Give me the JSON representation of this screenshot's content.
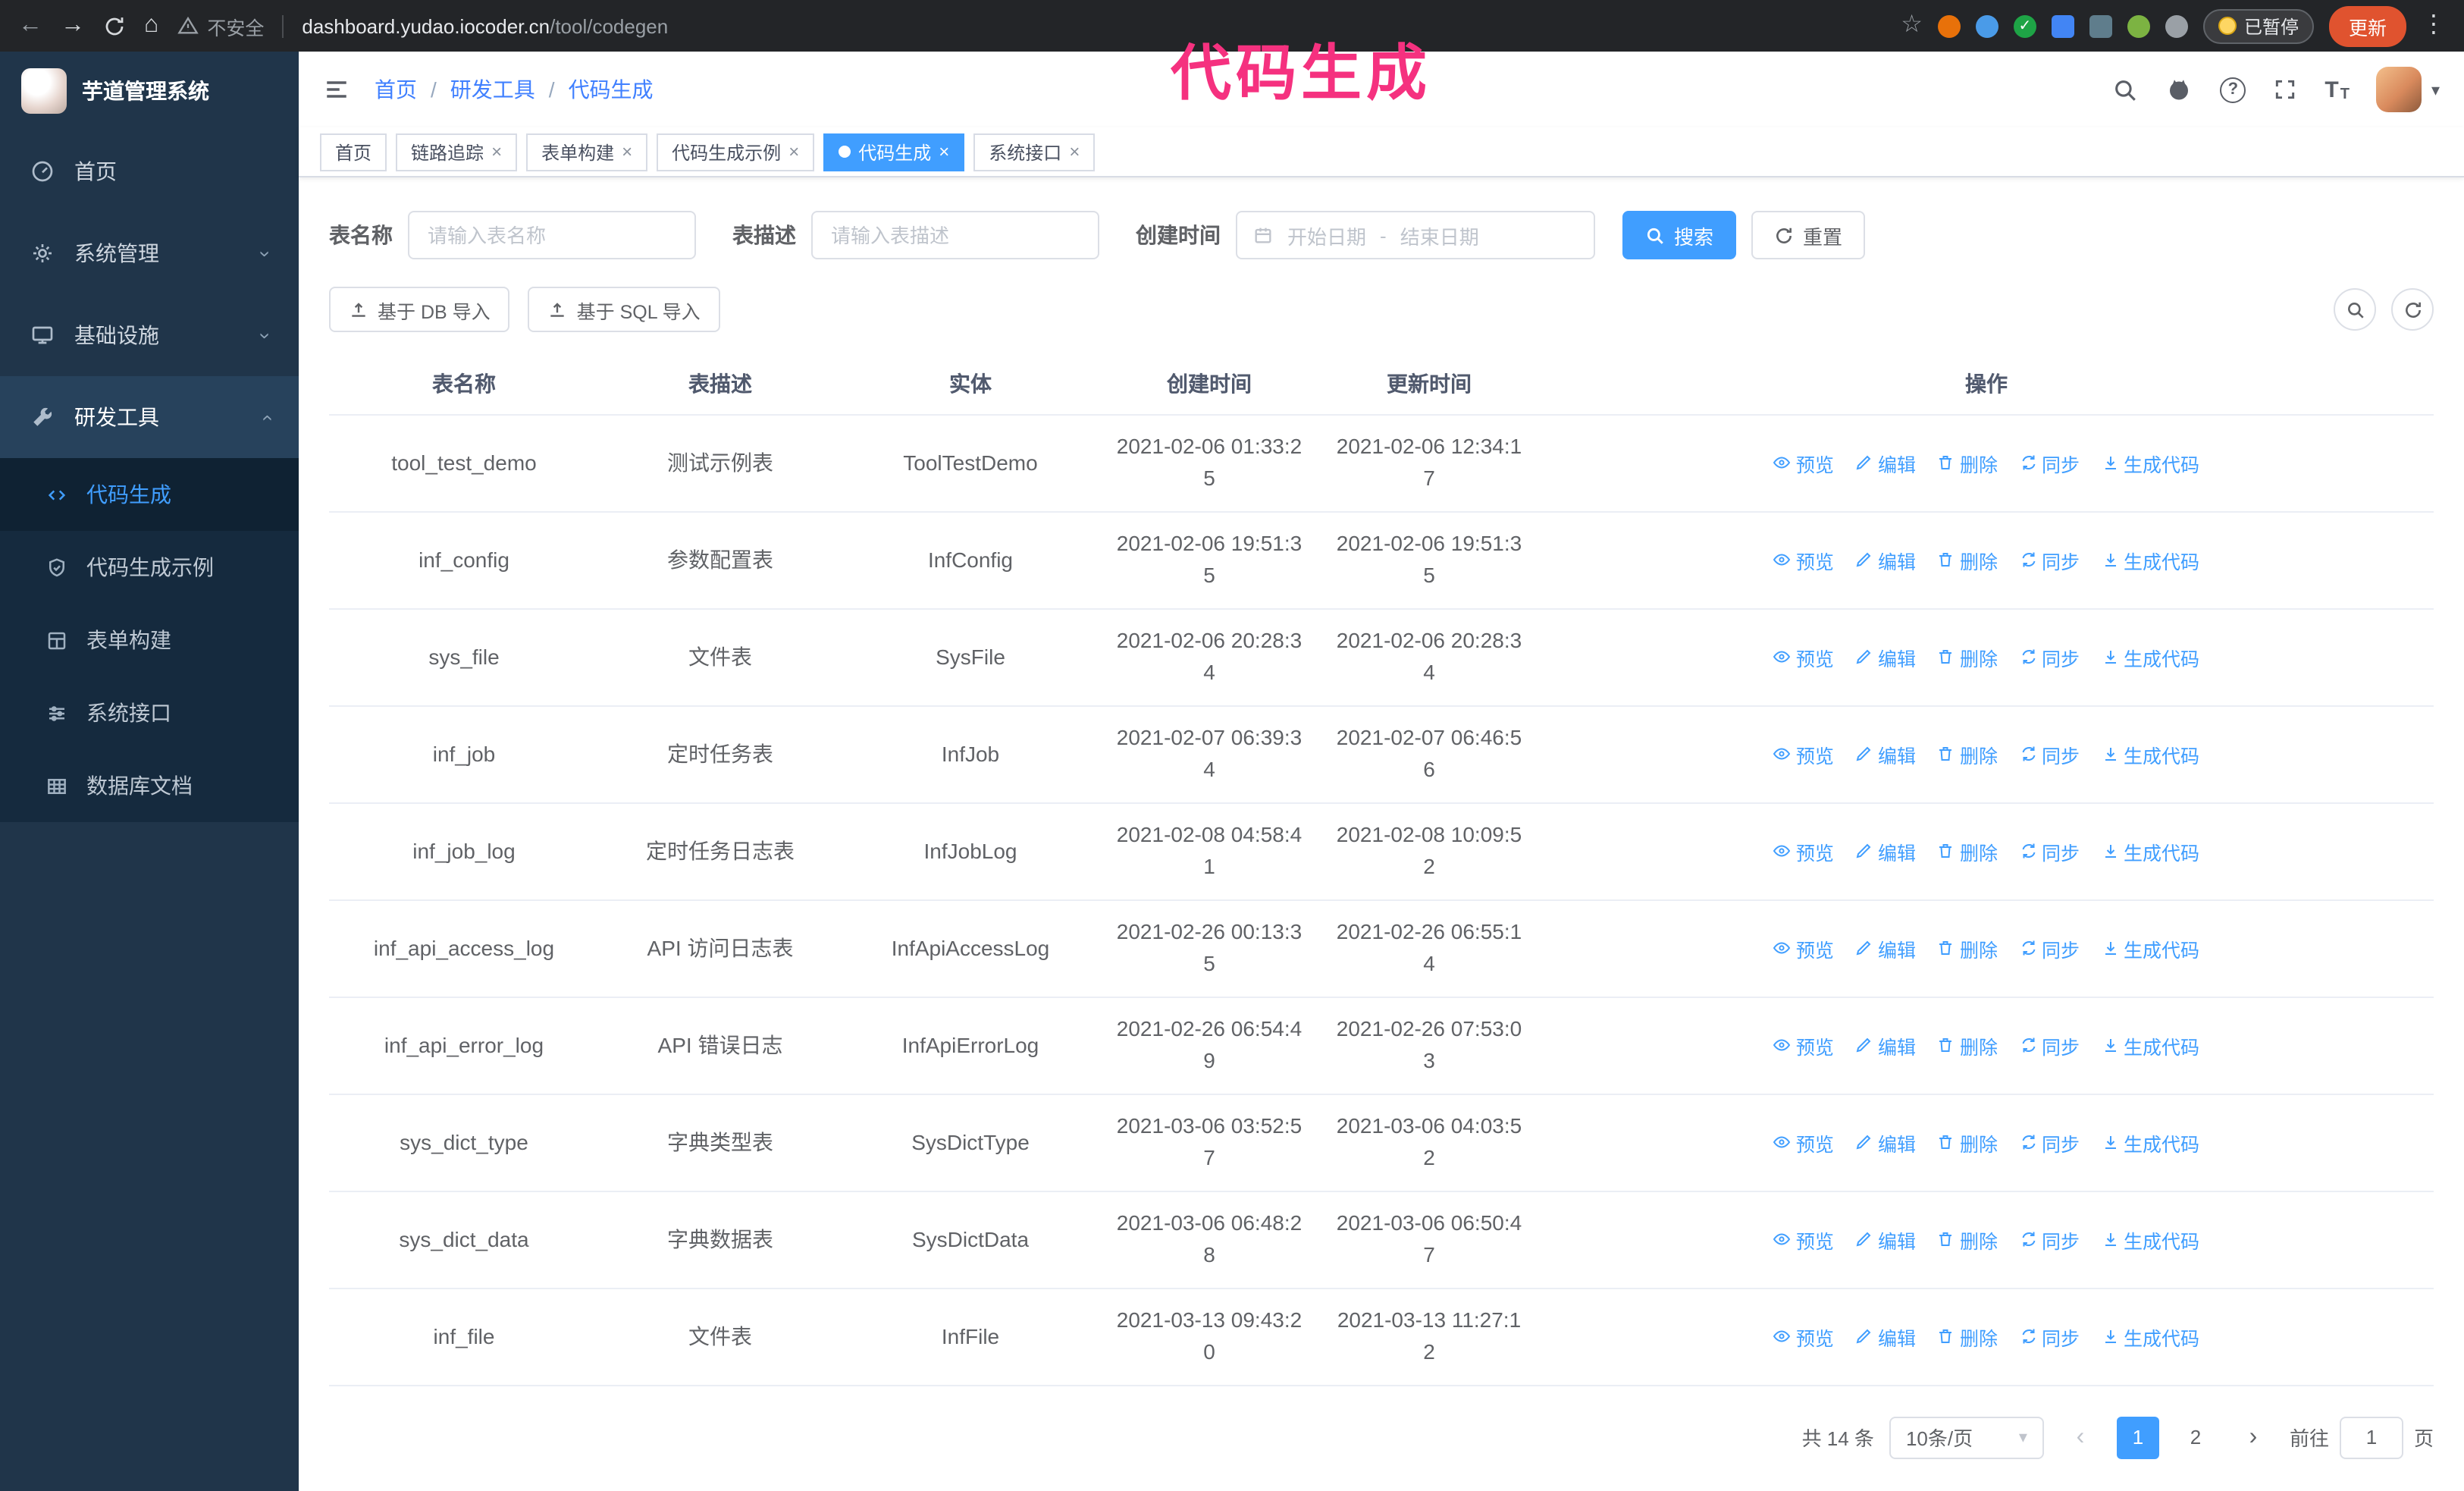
{
  "browser": {
    "security_label": "不安全",
    "url_host": "dashboard.yudao.iocoder.cn",
    "url_path": "/tool/codegen",
    "paused_badge": "已暂停",
    "update_button": "更新"
  },
  "annotation": {
    "text": "代码生成",
    "color": "#f5317f"
  },
  "icons": {
    "back": "←",
    "forward": "→",
    "home": "⌂",
    "star": "☆",
    "overflow_menu": "⋮",
    "question": "?",
    "font_size_big": "T",
    "font_size_small": "T",
    "caret_down": "▾",
    "chevron": "›",
    "prev": "‹",
    "next": "›",
    "close": "×",
    "check": "✓"
  },
  "sidebar": {
    "logo_title": "芋道管理系统",
    "items": [
      {
        "label": "首页",
        "icon": "dashboard-icon"
      },
      {
        "label": "系统管理",
        "icon": "gear-icon",
        "expandable": true
      },
      {
        "label": "基础设施",
        "icon": "infrastructure-icon",
        "expandable": true
      },
      {
        "label": "研发工具",
        "icon": "tools-icon",
        "expandable": true,
        "expanded": true
      }
    ],
    "submenu": [
      {
        "label": "代码生成",
        "icon": "code-icon",
        "active": true
      },
      {
        "label": "代码生成示例",
        "icon": "shield-icon"
      },
      {
        "label": "表单构建",
        "icon": "form-icon"
      },
      {
        "label": "系统接口",
        "icon": "api-icon"
      },
      {
        "label": "数据库文档",
        "icon": "database-icon"
      }
    ]
  },
  "breadcrumb": {
    "items": [
      "首页",
      "研发工具",
      "代码生成"
    ],
    "separator": "/"
  },
  "tabs": [
    {
      "label": "首页",
      "closable": false,
      "active": false
    },
    {
      "label": "链路追踪",
      "closable": true,
      "active": false
    },
    {
      "label": "表单构建",
      "closable": true,
      "active": false
    },
    {
      "label": "代码生成示例",
      "closable": true,
      "active": false
    },
    {
      "label": "代码生成",
      "closable": true,
      "active": true
    },
    {
      "label": "系统接口",
      "closable": true,
      "active": false
    }
  ],
  "filters": {
    "table_name_label": "表名称",
    "table_name_placeholder": "请输入表名称",
    "table_desc_label": "表描述",
    "table_desc_placeholder": "请输入表描述",
    "create_time_label": "创建时间",
    "date_start_placeholder": "开始日期",
    "date_separator": "-",
    "date_end_placeholder": "结束日期",
    "search_button": "搜索",
    "reset_button": "重置"
  },
  "toolbar": {
    "import_db_button": "基于 DB 导入",
    "import_sql_button": "基于 SQL 导入"
  },
  "table": {
    "columns": [
      "表名称",
      "表描述",
      "实体",
      "创建时间",
      "更新时间",
      "操作"
    ],
    "actions": [
      "预览",
      "编辑",
      "删除",
      "同步",
      "生成代码"
    ],
    "rows": [
      {
        "name": "tool_test_demo",
        "desc": "测试示例表",
        "entity": "ToolTestDemo",
        "created": "2021-02-06 01:33:25",
        "updated": "2021-02-06 12:34:17"
      },
      {
        "name": "inf_config",
        "desc": "参数配置表",
        "entity": "InfConfig",
        "created": "2021-02-06 19:51:35",
        "updated": "2021-02-06 19:51:35"
      },
      {
        "name": "sys_file",
        "desc": "文件表",
        "entity": "SysFile",
        "created": "2021-02-06 20:28:34",
        "updated": "2021-02-06 20:28:34"
      },
      {
        "name": "inf_job",
        "desc": "定时任务表",
        "entity": "InfJob",
        "created": "2021-02-07 06:39:34",
        "updated": "2021-02-07 06:46:56"
      },
      {
        "name": "inf_job_log",
        "desc": "定时任务日志表",
        "entity": "InfJobLog",
        "created": "2021-02-08 04:58:41",
        "updated": "2021-02-08 10:09:52"
      },
      {
        "name": "inf_api_access_log",
        "desc": "API 访问日志表",
        "entity": "InfApiAccessLog",
        "created": "2021-02-26 00:13:35",
        "updated": "2021-02-26 06:55:14"
      },
      {
        "name": "inf_api_error_log",
        "desc": "API 错误日志",
        "entity": "InfApiErrorLog",
        "created": "2021-02-26 06:54:49",
        "updated": "2021-02-26 07:53:03"
      },
      {
        "name": "sys_dict_type",
        "desc": "字典类型表",
        "entity": "SysDictType",
        "created": "2021-03-06 03:52:57",
        "updated": "2021-03-06 04:03:52"
      },
      {
        "name": "sys_dict_data",
        "desc": "字典数据表",
        "entity": "SysDictData",
        "created": "2021-03-06 06:48:28",
        "updated": "2021-03-06 06:50:47"
      },
      {
        "name": "inf_file",
        "desc": "文件表",
        "entity": "InfFile",
        "created": "2021-03-13 09:43:20",
        "updated": "2021-03-13 11:27:12"
      }
    ]
  },
  "pagination": {
    "total": "共 14 条",
    "page_size": "10条/页",
    "pages": [
      "1",
      "2"
    ],
    "active_page": "1",
    "goto_label": "前往",
    "goto_value": "1",
    "goto_unit": "页"
  }
}
